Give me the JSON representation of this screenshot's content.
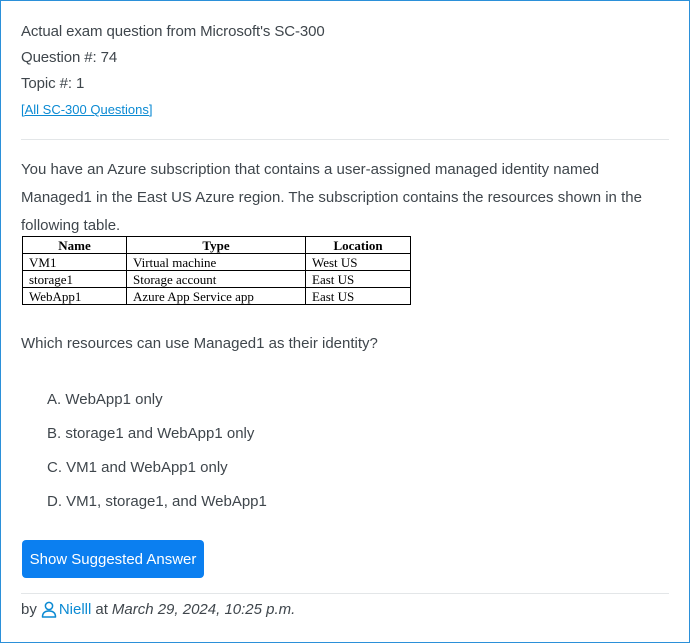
{
  "header": {
    "title": "Actual exam question from Microsoft's SC-300",
    "question_number": "Question #: 74",
    "topic": "Topic #: 1",
    "all_questions_link": "[All SC-300 Questions]"
  },
  "question": {
    "text": "You have an Azure subscription that contains a user-assigned managed identity named Managed1 in the East US Azure region. The subscription contains the resources shown in the following table.",
    "table": {
      "headers": [
        "Name",
        "Type",
        "Location"
      ],
      "rows": [
        [
          "VM1",
          "Virtual machine",
          "West US"
        ],
        [
          "storage1",
          "Storage account",
          "East US"
        ],
        [
          "WebApp1",
          "Azure App Service app",
          "East US"
        ]
      ]
    },
    "prompt": "Which resources can use Managed1 as their identity?",
    "choices": [
      "A. WebApp1 only",
      "B. storage1 and WebApp1 only",
      "C. VM1 and WebApp1 only",
      "D. VM1, storage1, and WebApp1"
    ]
  },
  "actions": {
    "show_answer_label": "Show Suggested Answer"
  },
  "footer": {
    "by": "by",
    "user_icon": "user-icon",
    "author": "Nielll",
    "at": "at",
    "date": "March 29, 2024, 10:25 p.m."
  },
  "colors": {
    "accent": "#0b7ff0",
    "link": "#0b8ad3",
    "border": "#2b90d9"
  }
}
